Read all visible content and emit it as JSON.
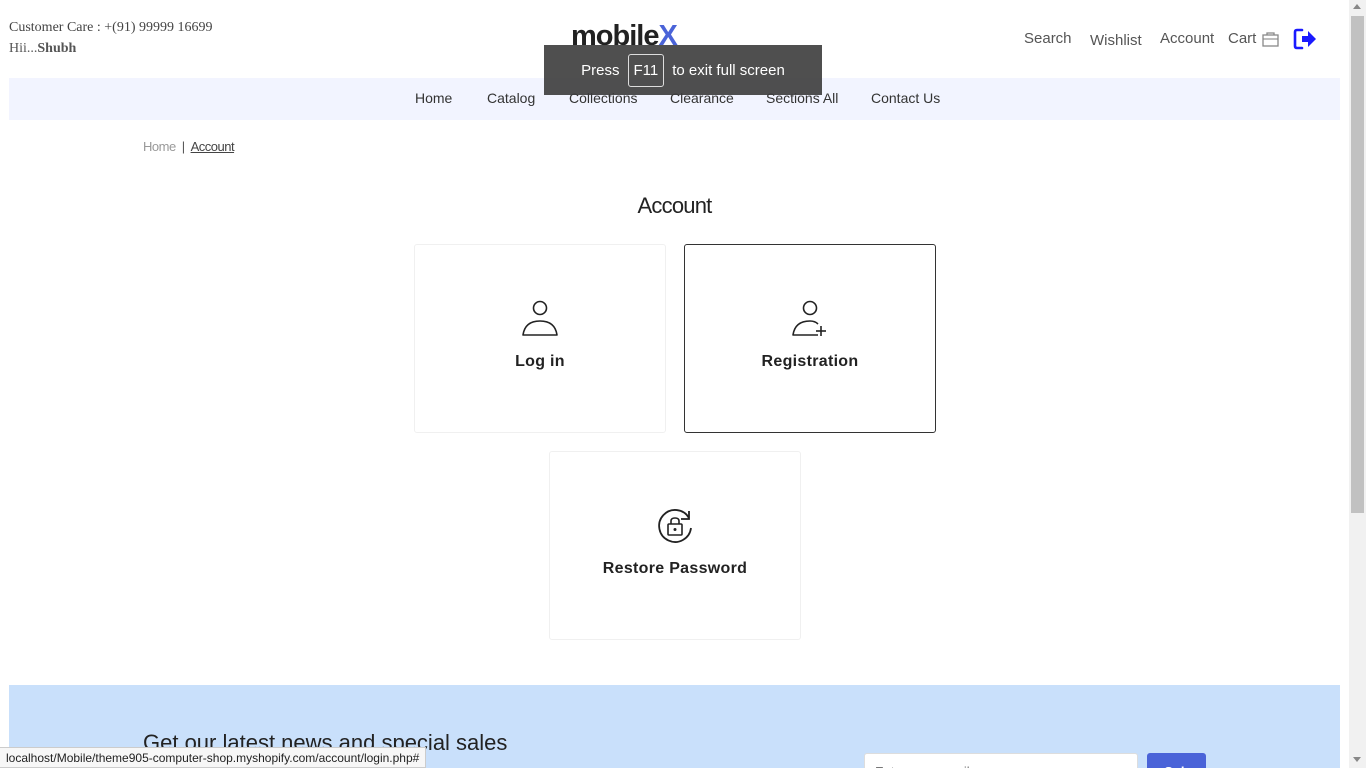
{
  "header": {
    "customer_care": "Customer Care : +(91) 99999 16699",
    "greeting_prefix": "Hii...",
    "greeting_name": "Shubh",
    "logo_main": "mobile",
    "logo_accent": "X",
    "nav": {
      "search": "Search",
      "wishlist": "Wishlist",
      "account": "Account",
      "cart": "Cart"
    },
    "icons": {
      "cart": "shopping-bag-icon",
      "logout": "logout-icon"
    }
  },
  "fullscreen_toast": {
    "before": "Press",
    "key": "F11",
    "after": "to exit full screen"
  },
  "main_nav": {
    "items": [
      "Home",
      "Catalog",
      "Collections",
      "Clearance",
      "Sections All",
      "Contact Us"
    ]
  },
  "breadcrumb": {
    "home": "Home",
    "separator": "|",
    "current": "Account"
  },
  "page_title": "Account",
  "cards": [
    {
      "label": "Log in",
      "icon": "user-icon"
    },
    {
      "label": "Registration",
      "icon": "user-add-icon"
    },
    {
      "label": "Restore Password",
      "icon": "lock-refresh-icon"
    }
  ],
  "newsletter": {
    "heading": "Get our latest news and special sales",
    "email_placeholder": "Enter your email",
    "submit": "Sub"
  },
  "status_bar": "localhost/Mobile/theme905-computer-shop.myshopify.com/account/login.php#",
  "colors": {
    "accent": "#4a63d8",
    "nav_bg": "#f2f4ff",
    "newsletter_bg": "#c9e0fb",
    "logout_icon": "#1a1aff"
  }
}
